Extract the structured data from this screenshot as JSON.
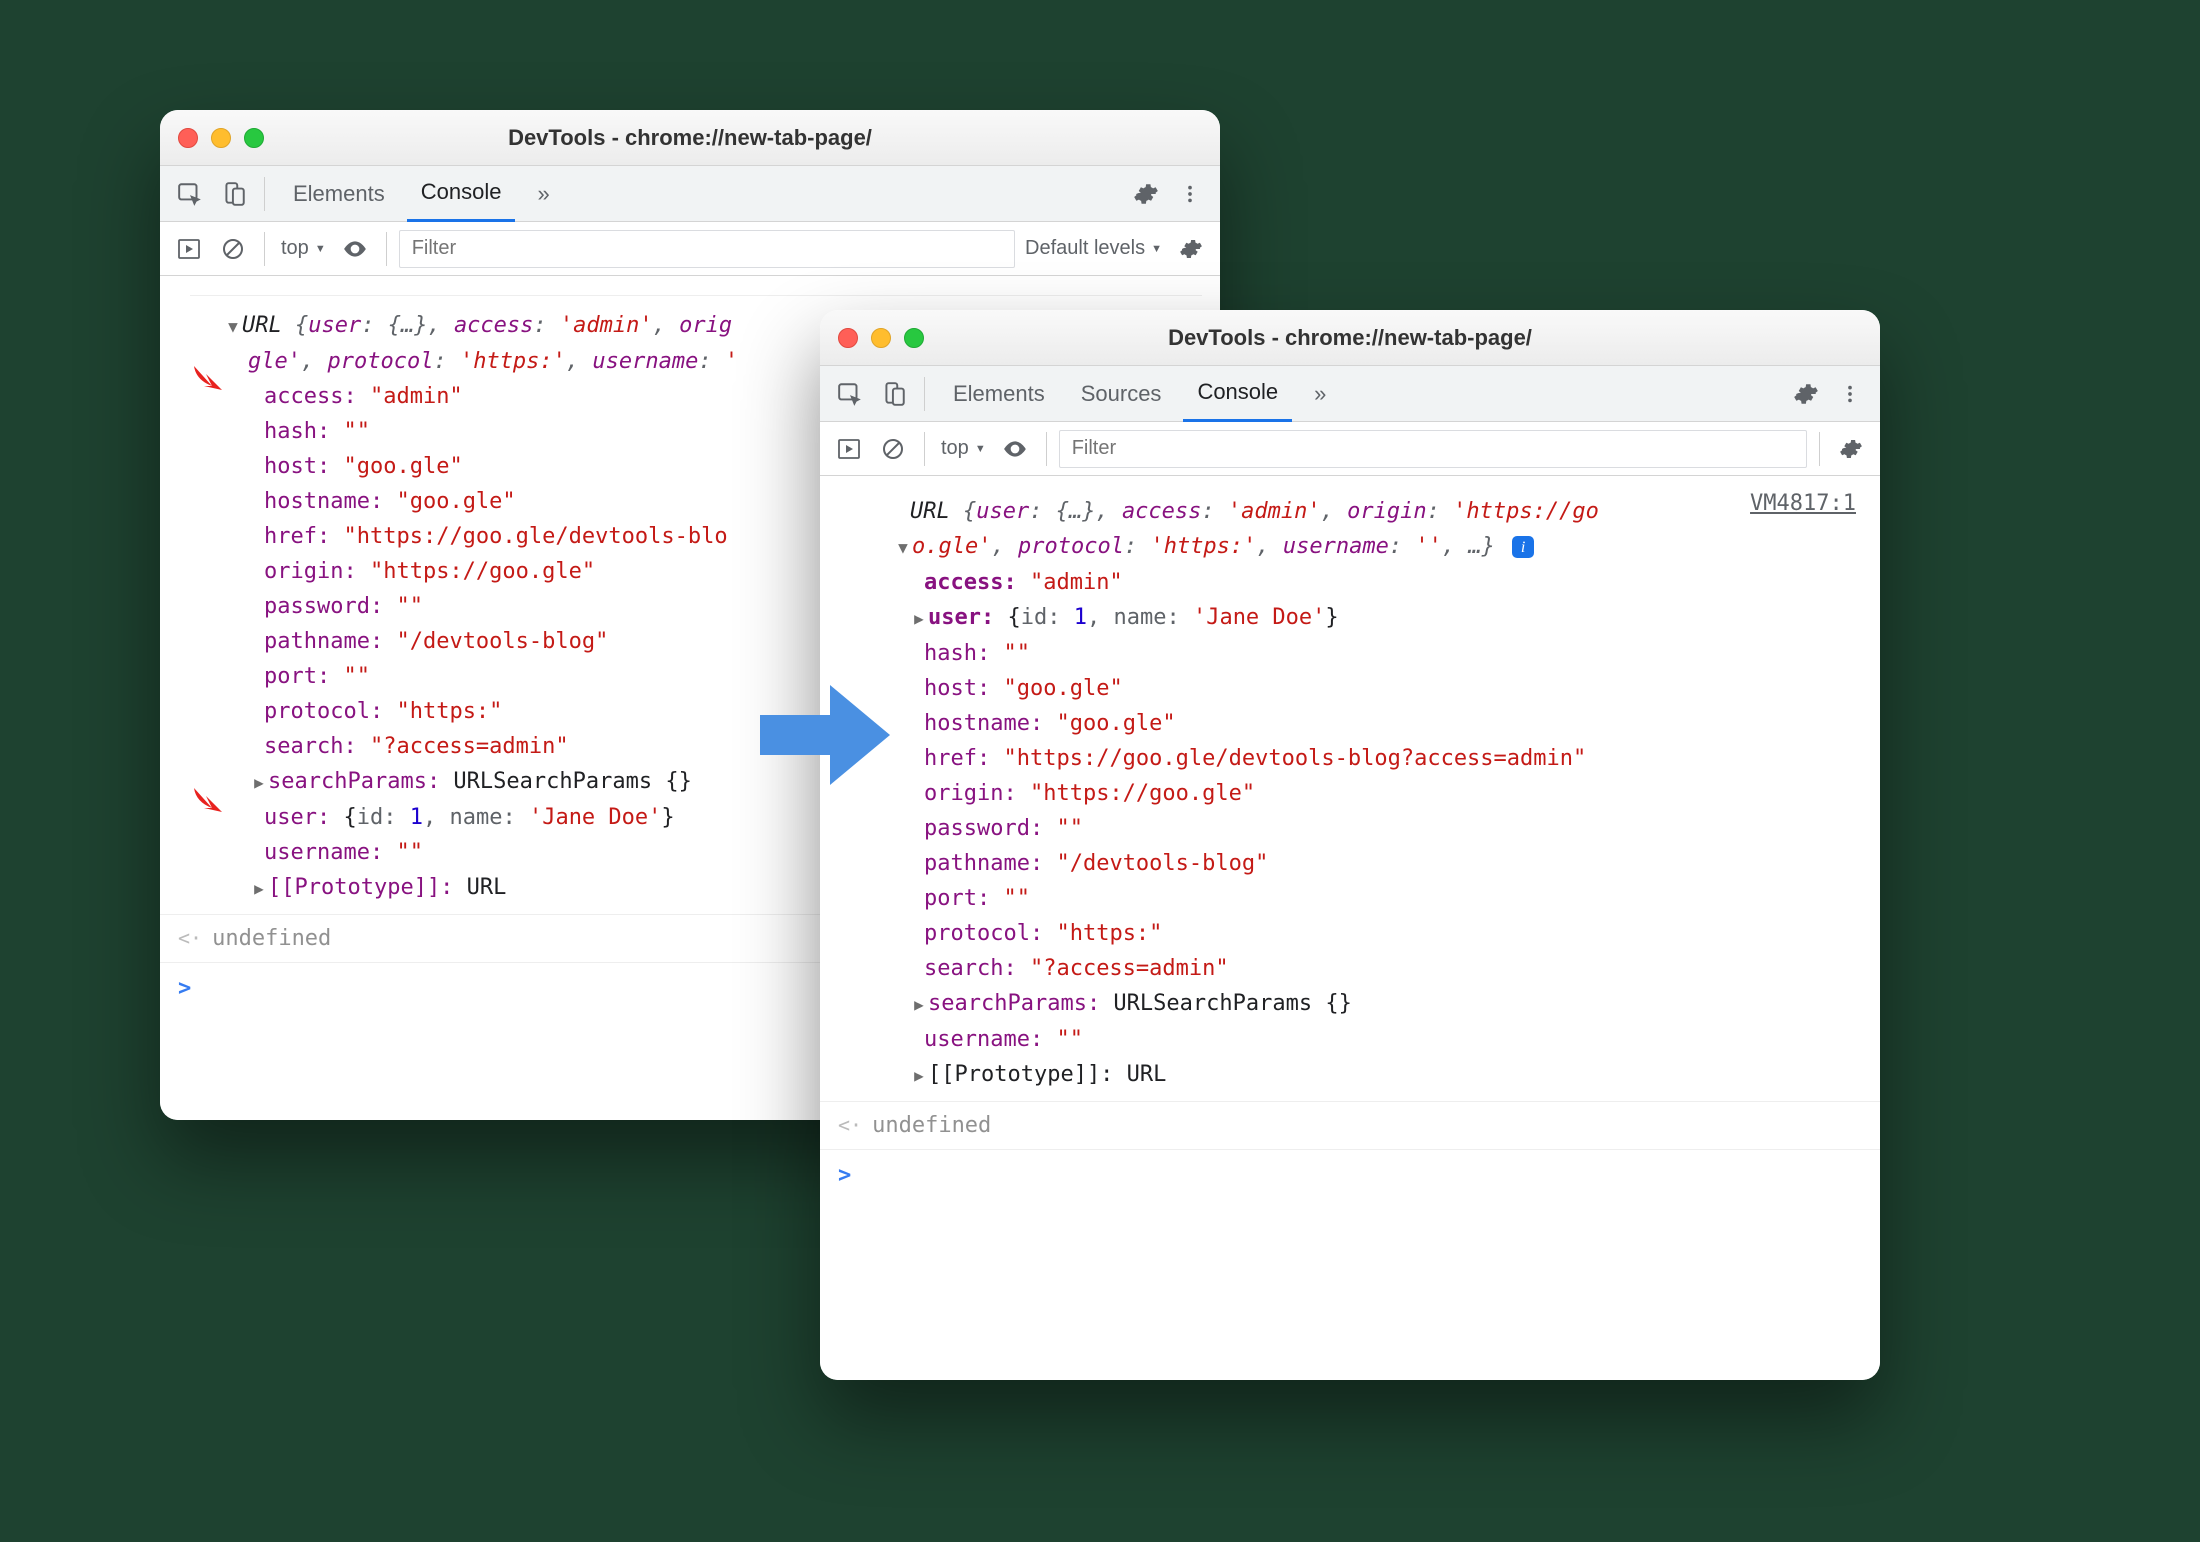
{
  "left": {
    "title": "DevTools - chrome://new-tab-page/",
    "tabs": {
      "elements": "Elements",
      "console": "Console",
      "more": "»"
    },
    "filter": {
      "context": "top",
      "placeholder": "Filter",
      "levels": "Default levels"
    },
    "summary_l1": "URL {user: {…}, access: 'admin', orig",
    "summary_l2": "gle', protocol: 'https:', username: '",
    "props": {
      "access_k": "access:",
      "access_v": " \"admin\"",
      "hash_k": "hash:",
      "hash_v": " \"\"",
      "host_k": "host:",
      "host_v": " \"goo.gle\"",
      "hostname_k": "hostname:",
      "hostname_v": " \"goo.gle\"",
      "href_k": "href:",
      "href_v": " \"https://goo.gle/devtools-blo",
      "origin_k": "origin:",
      "origin_v": " \"https://goo.gle\"",
      "password_k": "password:",
      "password_v": " \"\"",
      "pathname_k": "pathname:",
      "pathname_v": " \"/devtools-blog\"",
      "port_k": "port:",
      "port_v": " \"\"",
      "protocol_k": "protocol:",
      "protocol_v": " \"https:\"",
      "search_k": "search:",
      "search_v": " \"?access=admin\"",
      "searchParams_k": "searchParams:",
      "searchParams_v": " URLSearchParams {}",
      "user_k": "user:",
      "user_open": " {",
      "user_id_k": "id: ",
      "user_id_v": "1",
      "user_sep": ", ",
      "user_name_k": "name: ",
      "user_name_v": "'Jane Doe'",
      "user_close": "}",
      "username_k": "username:",
      "username_v": " \"\"",
      "proto_k": "[[Prototype]]:",
      "proto_v": " URL"
    },
    "undefined": "undefined"
  },
  "right": {
    "title": "DevTools - chrome://new-tab-page/",
    "tabs": {
      "elements": "Elements",
      "sources": "Sources",
      "console": "Console",
      "more": "»"
    },
    "filter": {
      "context": "top",
      "placeholder": "Filter"
    },
    "link": "VM4817:1",
    "summary_l1": "URL {user: {…}, access: 'admin', origin: 'https://go",
    "summary_l2a": "o.gle', protocol: 'https:', username: '', …}",
    "props": {
      "access_k": "access:",
      "access_v": " \"admin\"",
      "user_k": "user:",
      "user_open": " {",
      "user_id_k": "id: ",
      "user_id_v": "1",
      "user_sep": ", ",
      "user_name_k": "name: ",
      "user_name_v": "'Jane Doe'",
      "user_close": "}",
      "hash_k": "hash:",
      "hash_v": " \"\"",
      "host_k": "host:",
      "host_v": " \"goo.gle\"",
      "hostname_k": "hostname:",
      "hostname_v": " \"goo.gle\"",
      "href_k": "href:",
      "href_v": " \"https://goo.gle/devtools-blog?access=admin\"",
      "origin_k": "origin:",
      "origin_v": " \"https://goo.gle\"",
      "password_k": "password:",
      "password_v": " \"\"",
      "pathname_k": "pathname:",
      "pathname_v": " \"/devtools-blog\"",
      "port_k": "port:",
      "port_v": " \"\"",
      "protocol_k": "protocol:",
      "protocol_v": " \"https:\"",
      "search_k": "search:",
      "search_v": " \"?access=admin\"",
      "searchParams_k": "searchParams:",
      "searchParams_v": " URLSearchParams {}",
      "username_k": "username:",
      "username_v": " \"\"",
      "proto_k": "[[Prototype]]:",
      "proto_v": " URL"
    },
    "undefined": "undefined",
    "info_i": "i"
  }
}
